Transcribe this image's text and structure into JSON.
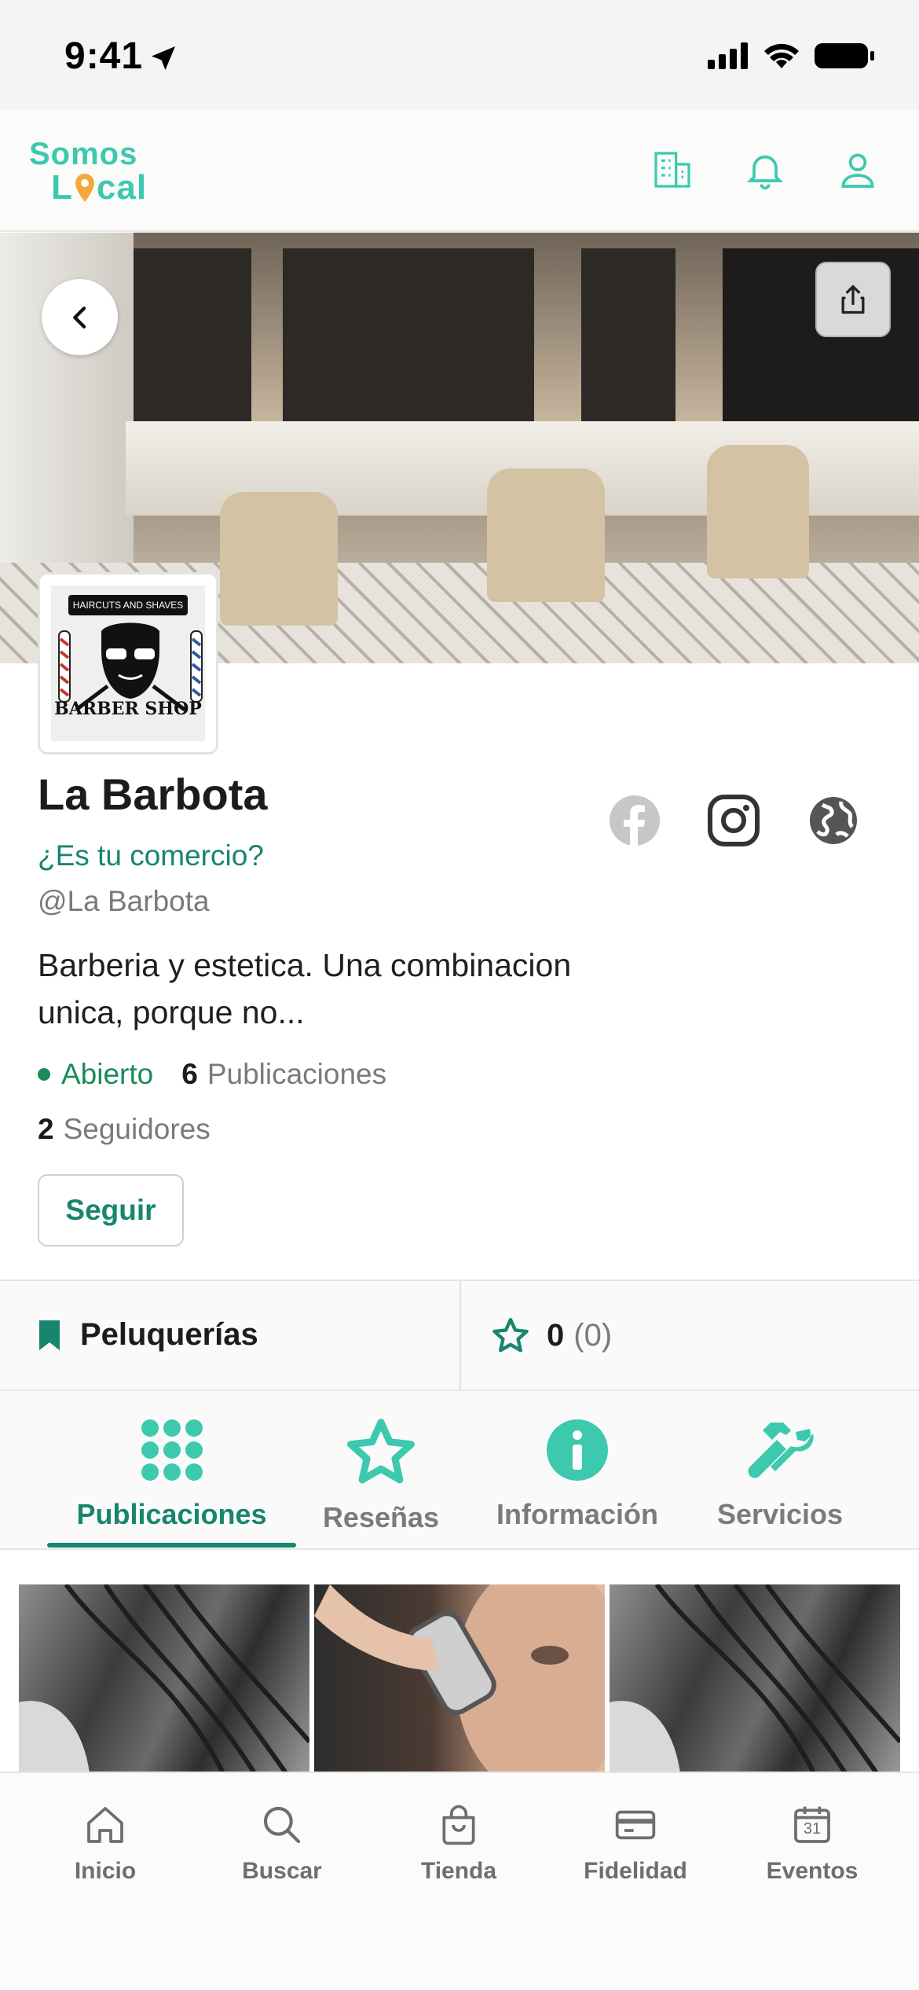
{
  "status_bar": {
    "time": "9:41"
  },
  "header": {
    "logo_top": "Somos",
    "logo_bottom_before": "L",
    "logo_bottom_after": "cal",
    "icons": [
      "building-icon",
      "bell-icon",
      "user-icon"
    ]
  },
  "hero": {
    "back_icon": "chevron-left-icon",
    "share_icon": "share-icon"
  },
  "avatar": {
    "tag": "HAIRCUTS AND SHAVES",
    "caption": "BARBER SHOP"
  },
  "profile": {
    "name": "La Barbota",
    "claim_link": "¿Es tu comercio?",
    "handle": "@La Barbota",
    "description": "Barberia y estetica. Una combinacion unica, porque no...",
    "status": "Abierto",
    "publications_count": "6",
    "publications_label": "Publicaciones",
    "followers_count": "2",
    "followers_label": "Seguidores",
    "follow_button": "Seguir",
    "social_icons": [
      "facebook-icon",
      "instagram-icon",
      "globe-icon"
    ]
  },
  "info": {
    "category": "Peluquerías",
    "rating_value": "0",
    "rating_count": "(0)"
  },
  "tabs": [
    {
      "label": "Publicaciones",
      "icon": "grid-dots-icon",
      "active": true
    },
    {
      "label": "Reseñas",
      "icon": "star-icon",
      "active": false
    },
    {
      "label": "Información",
      "icon": "info-icon",
      "active": false
    },
    {
      "label": "Servicios",
      "icon": "tools-icon",
      "active": false
    }
  ],
  "bottom_nav": [
    {
      "label": "Inicio",
      "icon": "home-icon"
    },
    {
      "label": "Buscar",
      "icon": "search-icon"
    },
    {
      "label": "Tienda",
      "icon": "shopping-bag-icon"
    },
    {
      "label": "Fidelidad",
      "icon": "card-icon"
    },
    {
      "label": "Eventos",
      "icon": "calendar-icon",
      "calendar_day": "31"
    }
  ],
  "colors": {
    "accent": "#17866f",
    "brand": "#3cc9ae",
    "open": "#1b8a5a"
  }
}
